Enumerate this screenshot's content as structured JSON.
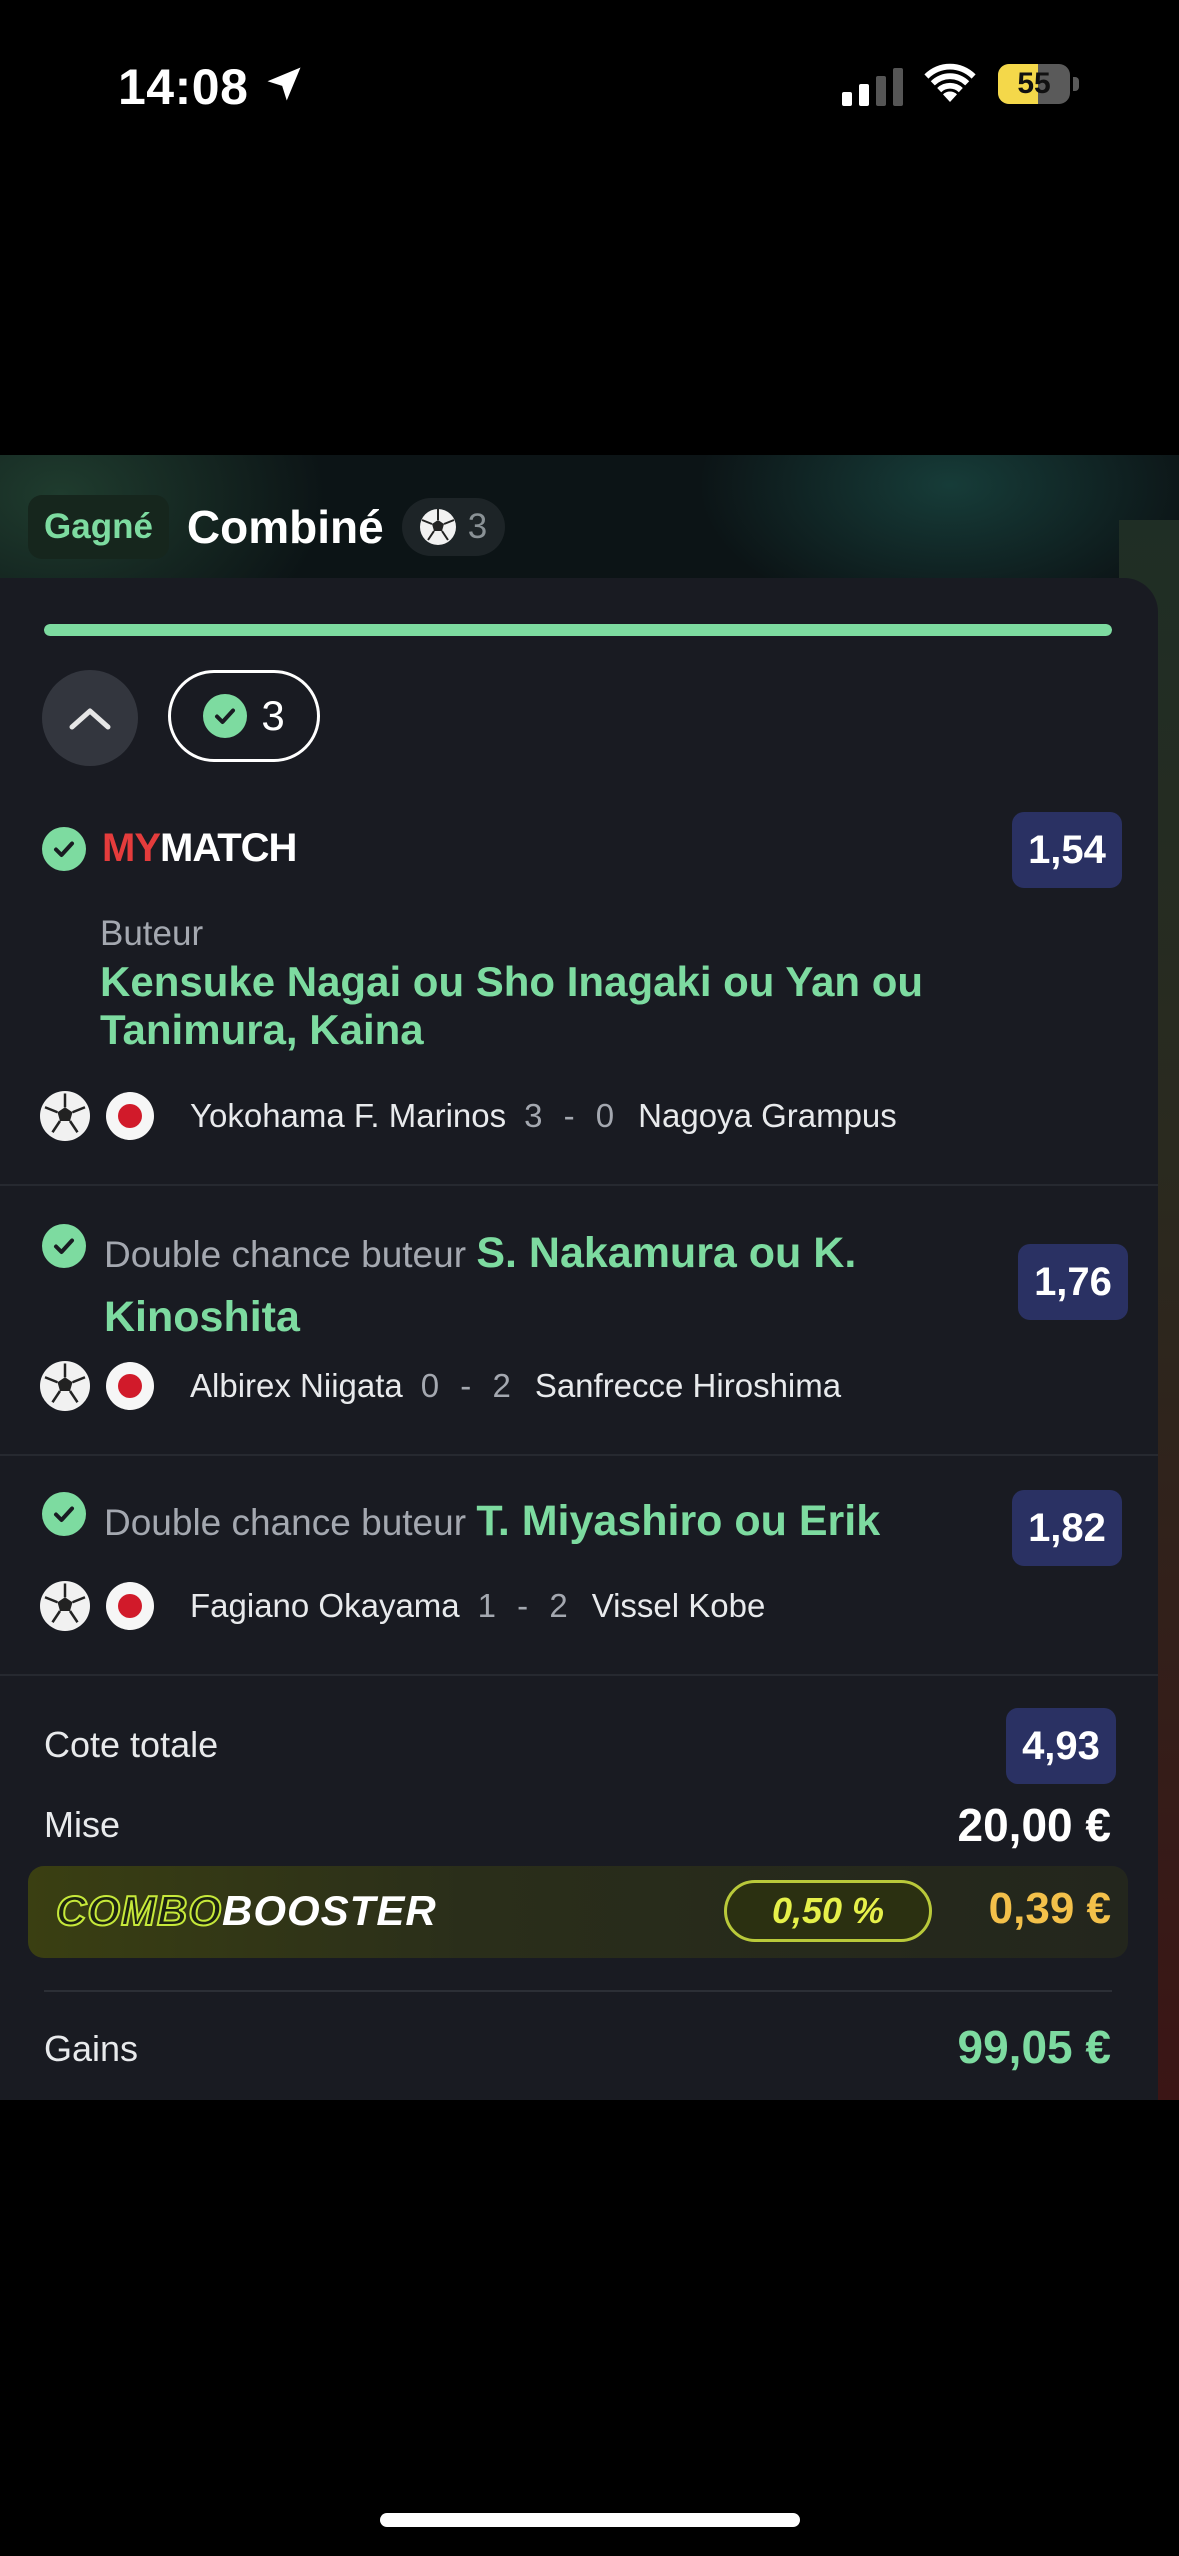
{
  "status_bar": {
    "time": "14:08",
    "battery": "55",
    "battery_level": 0.55
  },
  "header": {
    "status_label": "Gagné",
    "title": "Combiné",
    "sport_icon": "soccer-ball-icon",
    "selection_count": "3"
  },
  "progress": {
    "fraction": 1.0
  },
  "controls": {
    "won_count": "3"
  },
  "bets": [
    {
      "logo_my": "MY",
      "logo_match": "MATCH",
      "odds": "1,54",
      "selection_label": "Buteur",
      "selection_name": "Kensuke Nagai ou Sho Inagaki ou Yan ou Tanimura, Kaina",
      "home": "Yokohama F. Marinos",
      "score": "3 - 0",
      "away": "Nagoya Grampus"
    },
    {
      "market": "Double chance buteur",
      "selection_name": "S. Nakamura ou K. Kinoshita",
      "odds": "1,76",
      "home": "Albirex Niigata",
      "score": "0 - 2",
      "away": "Sanfrecce Hiroshima"
    },
    {
      "market": "Double chance buteur",
      "selection_name": "T. Miyashiro ou Erik",
      "odds": "1,82",
      "home": "Fagiano Okayama",
      "score": "1 - 2",
      "away": "Vissel Kobe"
    }
  ],
  "summary": {
    "total_odds_label": "Cote totale",
    "total_odds": "4,93",
    "stake_label": "Mise",
    "stake": "20,00 €",
    "booster_logo_a": "COMBO",
    "booster_logo_b": "BOOSTER",
    "booster_pct": "0,50 %",
    "booster_value": "0,39 €",
    "winnings_label": "Gains",
    "winnings": "99,05 €"
  },
  "colors": {
    "accent": "#7ddba0",
    "odds_bg": "#2a3163",
    "card_bg": "#191b22",
    "booster_value": "#f3c04a"
  }
}
